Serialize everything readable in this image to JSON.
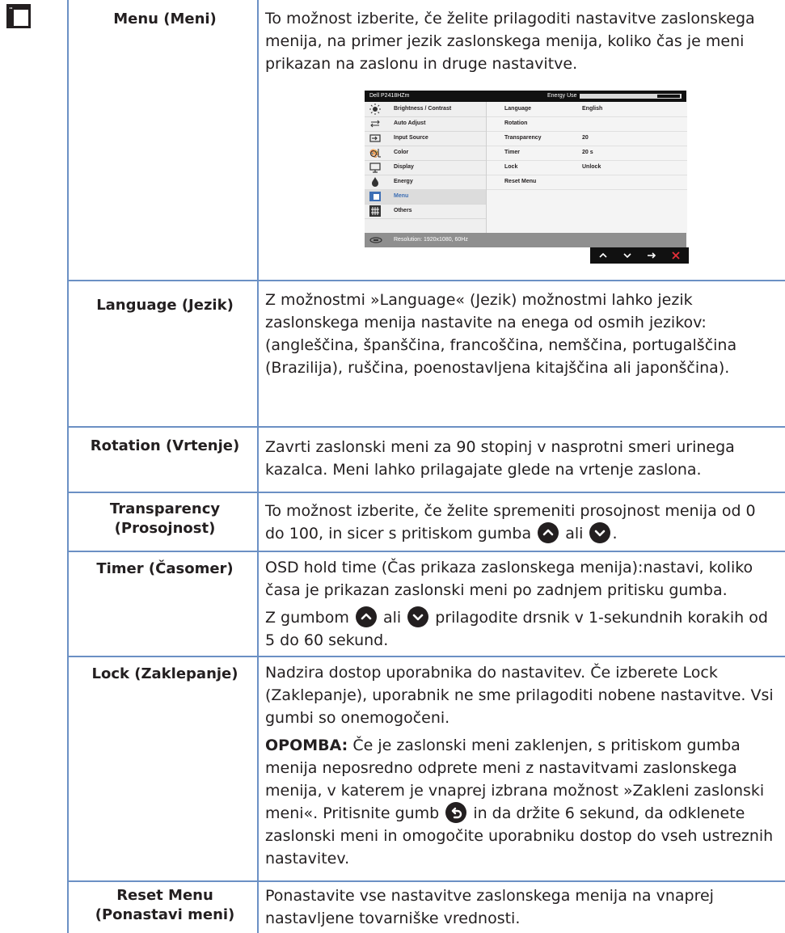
{
  "rows": {
    "menu": {
      "label": "Menu (Meni)",
      "desc": "To možnost izberite, če želite prilagoditi nastavitve zaslonskega menija, na primer jezik zaslonskega menija, koliko čas je meni prikazan na zaslonu in druge nastavitve."
    },
    "language": {
      "label": "Language (Jezik)",
      "desc": "Z možnostmi »Language« (Jezik) možnostmi lahko jezik zaslonskega menija nastavite na enega od osmih jezikov: (angleščina, španščina, francoščina, nemščina, portugalščina (Brazilija), ruščina, poenostavljena kitajščina ali japonščina)."
    },
    "rotation": {
      "label": "Rotation (Vrtenje)",
      "desc": "Zavrti zaslonski meni za 90 stopinj v nasprotni smeri urinega kazalca. Meni lahko prilagajate glede na vrtenje zaslona."
    },
    "transparency": {
      "label_line1": "Transparency",
      "label_line2": "(Prosojnost)",
      "desc_a": "To možnost izberite, če želite spremeniti prosojnost menija od 0 do 100, in sicer s pritiskom gumba",
      "desc_or": "ali",
      "desc_end": "."
    },
    "timer": {
      "label": "Timer (Časomer)",
      "desc1": "OSD hold time (Čas prikaza zaslonskega menija):nastavi, koliko časa je prikazan zaslonski meni po zadnjem pritisku gumba.",
      "desc2_a": "Z gumbom",
      "desc2_or": "ali",
      "desc2_b": "prilagodite drsnik v 1-sekundnih korakih od 5 do 60 sekund."
    },
    "lock": {
      "label": "Lock (Zaklepanje)",
      "desc1": "Nadzira dostop uporabnika do nastavitev. Če izberete Lock (Zaklepanje), uporabnik ne sme prilagoditi nobene nastavitve. Vsi gumbi so onemogočeni.",
      "note_label": "OPOMBA:",
      "note_a": " Če je zaslonski meni zaklenjen, s pritiskom gumba menija neposredno odprete meni z nastavitvami zaslonskega menija, v katerem je vnaprej izbrana možnost »Zakleni zaslonski meni«. Pritisnite gumb",
      "note_b": " in da držite 6 sekund, da odklenete zaslonski meni in omogočite uporabniku dostop do vseh ustreznih nastavitev."
    },
    "reset": {
      "label_line1": "Reset Menu",
      "label_line2": "(Ponastavi meni)",
      "desc": "Ponastavite vse nastavitve zaslonskega menija na vnaprej nastavljene tovarniške vrednosti."
    }
  },
  "osd": {
    "model": "Dell P2418HZm",
    "energy_label": "Energy Use",
    "energy_level": 0.22,
    "menu_items": [
      {
        "label": "Brightness / Contrast",
        "icon": "brightness-icon"
      },
      {
        "label": "Auto Adjust",
        "icon": "auto-adjust-icon"
      },
      {
        "label": "Input Source",
        "icon": "input-source-icon"
      },
      {
        "label": "Color",
        "icon": "color-icon"
      },
      {
        "label": "Display",
        "icon": "display-icon"
      },
      {
        "label": "Energy",
        "icon": "energy-icon"
      },
      {
        "label": "Menu",
        "icon": "menu-icon",
        "selected": true
      },
      {
        "label": "Others",
        "icon": "others-icon"
      }
    ],
    "settings": [
      {
        "label": "Language",
        "value": "English"
      },
      {
        "label": "Rotation",
        "value": ""
      },
      {
        "label": "Transparency",
        "value": "20"
      },
      {
        "label": "Timer",
        "value": "20 s"
      },
      {
        "label": "Lock",
        "value": "Unlock"
      },
      {
        "label": "Reset Menu",
        "value": ""
      }
    ],
    "resolution": "Resolution: 1920x1080, 60Hz",
    "nav_buttons": [
      "up-icon",
      "down-icon",
      "enter-icon",
      "exit-icon"
    ]
  }
}
